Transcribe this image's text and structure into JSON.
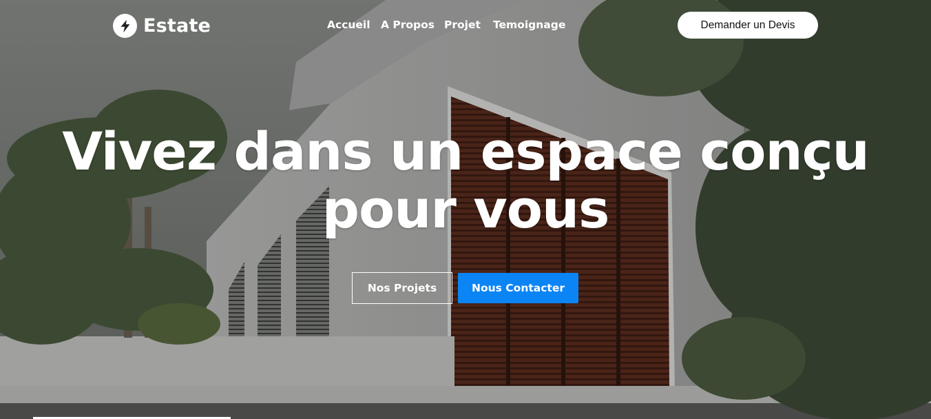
{
  "brand": {
    "name": "Estate",
    "icon": "lightning-bolt-icon"
  },
  "nav": {
    "items": [
      {
        "label": "Accueil"
      },
      {
        "label": "A Propos"
      },
      {
        "label": "Projet"
      },
      {
        "label": "Temoignage"
      }
    ],
    "cta_label": "Demander un Devis"
  },
  "hero": {
    "title_line1": "Vivez dans un espace conçu",
    "title_line2": "pour vous",
    "secondary_button": "Nos Projets",
    "primary_button": "Nous Contacter"
  },
  "colors": {
    "accent": "#0b84f5",
    "text": "#ffffff"
  }
}
